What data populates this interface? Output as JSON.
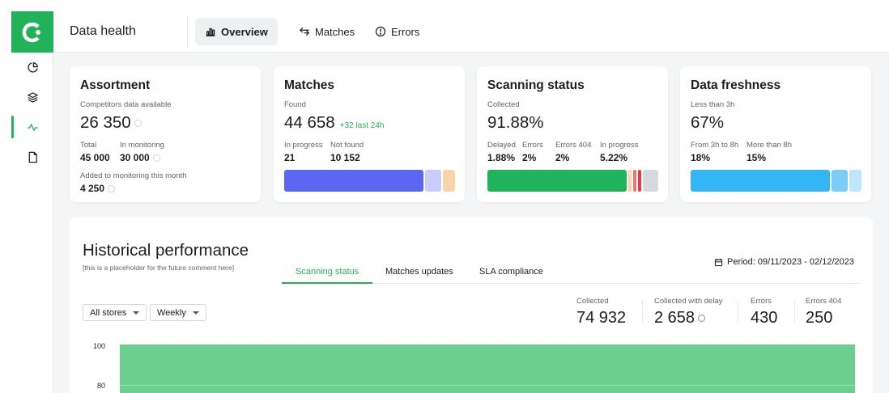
{
  "app": {
    "title": "Data health"
  },
  "tabs": [
    {
      "label": "Overview",
      "icon": "bar-chart-icon"
    },
    {
      "label": "Matches",
      "icon": "arrows-swap-icon"
    },
    {
      "label": "Errors",
      "icon": "alert-circle-icon"
    }
  ],
  "sidebar": {
    "items": [
      "pie-chart-icon",
      "layers-icon",
      "activity-icon",
      "document-icon"
    ],
    "active": "activity-icon"
  },
  "cards": {
    "assortment": {
      "title": "Assortment",
      "available_label": "Competitors data available",
      "available_value": "26 350",
      "total_label": "Total",
      "total_value": "45 000",
      "monitoring_label": "In monitoring",
      "monitoring_value": "30 000",
      "added_label": "Added to monitoring this month",
      "added_value": "4 250"
    },
    "matches": {
      "title": "Matches",
      "found_label": "Found",
      "found_value": "44 658",
      "found_delta": "+32 last 24h",
      "progress_label": "In progress",
      "progress_value": "21",
      "notfound_label": "Not found",
      "notfound_value": "10 152",
      "bar": [
        {
          "name": "Found",
          "color": "#5b67f0"
        },
        {
          "name": "In progress",
          "color": "#c9cdfa"
        },
        {
          "name": "Not found",
          "color": "#f9d4a6"
        }
      ]
    },
    "scanning": {
      "title": "Scanning status",
      "collected_label": "Collected",
      "collected_value": "91.88%",
      "delayed_label": "Delayed",
      "delayed_value": "1.88%",
      "errors_label": "Errors",
      "errors_value": "2%",
      "errors404_label": "Errors 404",
      "errors404_value": "2%",
      "inprogress_label": "In progress",
      "inprogress_value": "5.22%",
      "bar": [
        {
          "name": "Collected",
          "color": "#1fb35c"
        },
        {
          "name": "Delayed",
          "color": "#f9d4a6"
        },
        {
          "name": "Errors",
          "color": "#f0737a"
        },
        {
          "name": "Errors 404",
          "color": "#e13b45"
        },
        {
          "name": "In progress",
          "color": "#d7d9dd"
        }
      ]
    },
    "freshness": {
      "title": "Data freshness",
      "less_label": "Less than 3h",
      "less_value": "67%",
      "mid_label": "From 3h to 8h",
      "mid_value": "18%",
      "more_label": "More than 8h",
      "more_value": "15%",
      "bar": [
        {
          "name": "Less than 3h",
          "color": "#33b6f4"
        },
        {
          "name": "From 3h to 8h",
          "color": "#79cdf6"
        },
        {
          "name": "More than 8h",
          "color": "#bfe6fb"
        }
      ]
    }
  },
  "historical": {
    "title": "Historical performance",
    "subtitle": "[this is a placeholder for the future comment here]",
    "tabs": [
      "Scanning status",
      "Matches updates",
      "SLA compliance"
    ],
    "period": "Period: 09/11/2023 - 02/12/2023",
    "filters": {
      "store": "All stores",
      "interval": "Weekly"
    },
    "stats": [
      {
        "label": "Collected",
        "value": "74 932"
      },
      {
        "label": "Collected with delay",
        "value": "2 658"
      },
      {
        "label": "Errors",
        "value": "430"
      },
      {
        "label": "Errors 404",
        "value": "250"
      }
    ]
  },
  "chart_data": {
    "type": "bar",
    "y_ticks": [
      "100",
      "80"
    ],
    "series": [
      {
        "values": [
          100
        ]
      }
    ],
    "color": "#6ccf90"
  }
}
